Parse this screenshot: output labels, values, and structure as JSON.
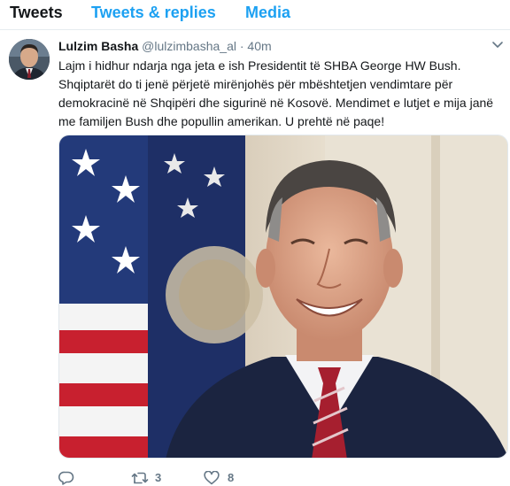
{
  "tabs": [
    {
      "label": "Tweets"
    },
    {
      "label": "Tweets & replies"
    },
    {
      "label": "Media"
    }
  ],
  "tweet": {
    "author_name": "Lulzim Basha",
    "handle": "@lulzimbasha_al",
    "separator": "·",
    "time": "40m",
    "text": "Lajm i hidhur ndarja nga jeta e ish Presidentit të SHBA George HW Bush. Shqiptarët do ti jenë përjetë mirënjohës për mbështetjen vendimtare për demokracinë në Shqipëri dhe sigurinë në Kosovë. Mendimet e lutjet e mija janë me familjen Bush dhe popullin amerikan. U prehtë në paqe!",
    "retweet_count": "3",
    "like_count": "8"
  },
  "icons": {
    "reply": "reply-icon",
    "retweet": "retweet-icon",
    "like": "heart-icon",
    "menu": "chevron-down-icon"
  },
  "colors": {
    "accent": "#1da1f2",
    "text": "#14171a",
    "muted": "#657786",
    "divider": "#e6ecf0"
  }
}
